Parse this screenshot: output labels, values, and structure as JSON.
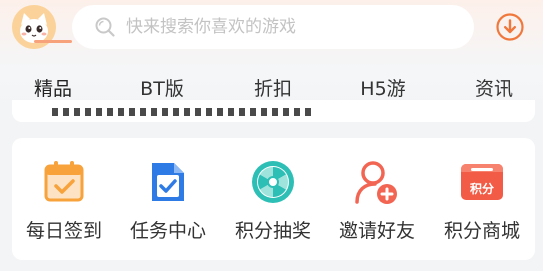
{
  "search": {
    "placeholder": "快来搜索你喜欢的游戏"
  },
  "tabs": [
    {
      "label": "精品",
      "active": true
    },
    {
      "label": "BT版"
    },
    {
      "label": "折扣"
    },
    {
      "label": "H5游"
    },
    {
      "label": "资讯"
    }
  ],
  "quick_actions": [
    {
      "label": "每日签到",
      "icon": "calendar-check-icon",
      "color": "#f7a23b"
    },
    {
      "label": "任务中心",
      "icon": "task-doc-icon",
      "color": "#2e7be6"
    },
    {
      "label": "积分抽奖",
      "icon": "lottery-wheel-icon",
      "color": "#2dbfb5"
    },
    {
      "label": "邀请好友",
      "icon": "invite-user-icon",
      "color": "#f26552"
    },
    {
      "label": "积分商城",
      "icon": "points-mall-icon",
      "color": "#f25b45",
      "badge": "积分"
    }
  ],
  "colors": {
    "accent": "#f7a27a",
    "download": "#f0783c"
  }
}
